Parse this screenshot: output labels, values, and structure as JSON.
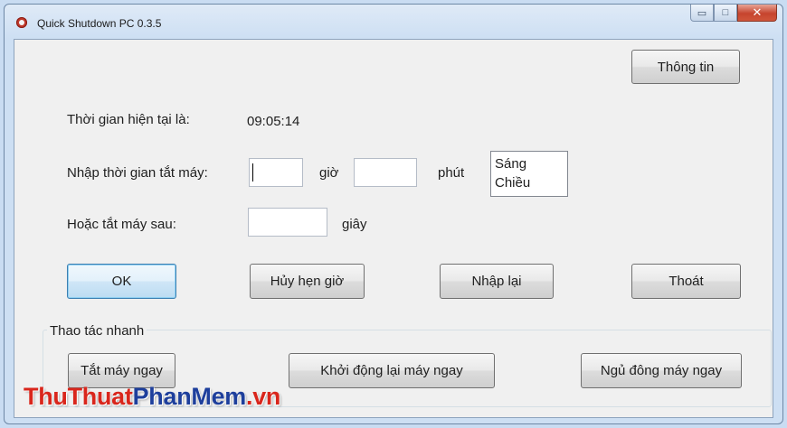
{
  "window": {
    "title": "Quick Shutdown PC 0.3.5",
    "controls": {
      "minimize": "▭",
      "maximize": "□",
      "close": "✕"
    }
  },
  "header": {
    "info_button": "Thông tin"
  },
  "form": {
    "current_time_label": "Thời gian hiện tại là:",
    "current_time_value": "09:05:14",
    "shutdown_time_label": "Nhập thời gian tắt máy:",
    "hours_unit": "giờ",
    "minutes_unit": "phút",
    "period_options": [
      "Sáng",
      "Chiều"
    ],
    "after_label": "Hoặc tắt máy sau:",
    "seconds_unit": "giây",
    "hours_value": "",
    "minutes_value": "",
    "seconds_value": ""
  },
  "actions": {
    "ok": "OK",
    "cancel_schedule": "Hủy hẹn giờ",
    "reset": "Nhập lại",
    "exit": "Thoát"
  },
  "quick": {
    "label": "Thao tác nhanh",
    "shutdown_now": "Tắt máy ngay",
    "restart_now": "Khởi động lại máy ngay",
    "hibernate_now": "Ngủ đông máy ngay"
  },
  "watermark": {
    "part1": "ThuThuat",
    "part2": "PhanMem",
    "part3": ".vn"
  },
  "colors": {
    "watermark_red": "#d9261c",
    "watermark_blue": "#1e3f9c",
    "default_button_border": "#3c7fb1"
  }
}
